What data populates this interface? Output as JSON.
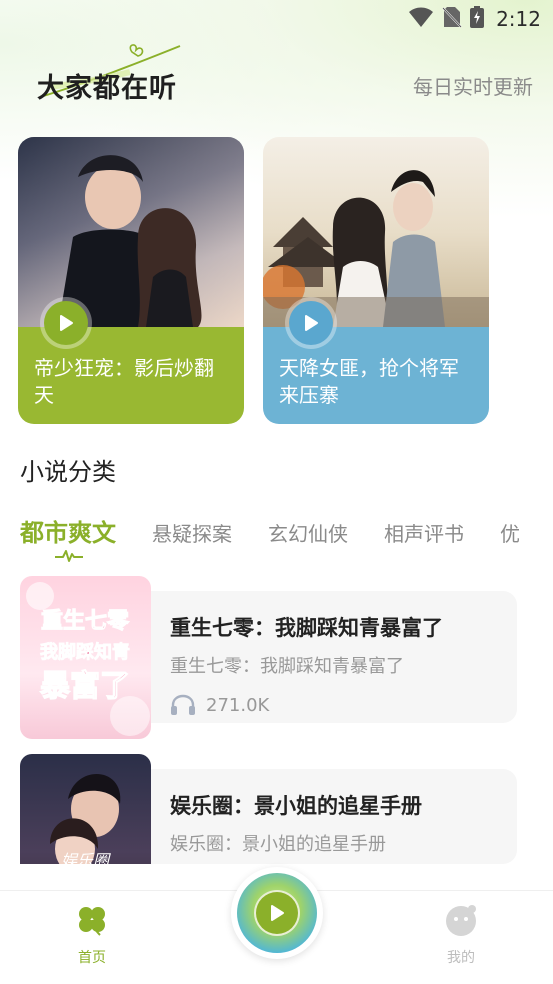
{
  "status_bar": {
    "time": "2:12"
  },
  "header": {
    "title": "大家都在听",
    "subtitle": "每日实时更新"
  },
  "featured": [
    {
      "title": "帝少狂宠：影后炒翻天",
      "band_color": "#99b832"
    },
    {
      "title": "天降女匪，抢个将军来压寨",
      "band_color": "#6db3d4"
    }
  ],
  "category_section": {
    "title": "小说分类",
    "tabs": [
      "都市爽文",
      "悬疑探案",
      "玄幻仙侠",
      "相声评书",
      "优"
    ],
    "active_tab": "都市爽文"
  },
  "books": [
    {
      "title": "重生七零：我脚踩知青暴富了",
      "subtitle": "重生七零：我脚踩知青暴富了",
      "plays": "271.0K",
      "cover_text": [
        "重生七零",
        "我脚踩知青",
        "暴富了"
      ]
    },
    {
      "title": "娱乐圈：景小姐的追星手册",
      "subtitle": "娱乐圈：景小姐的追星手册",
      "plays": "",
      "cover_text": [
        "娱乐圈"
      ]
    }
  ],
  "bottom_nav": {
    "home_label": "首页",
    "mine_label": "我的"
  },
  "colors": {
    "accent": "#8bb02a",
    "inactive": "#bdbdbd"
  }
}
